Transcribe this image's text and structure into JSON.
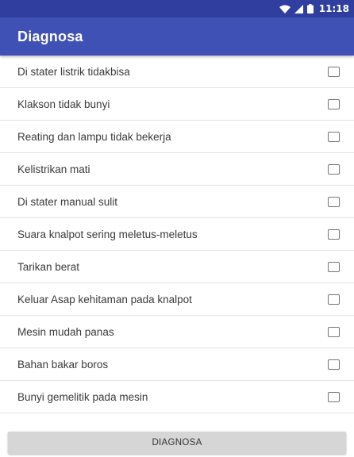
{
  "status_bar": {
    "time": "11:18",
    "icons": [
      "wifi-icon",
      "signal-icon",
      "battery-icon"
    ],
    "background": "#303f9f"
  },
  "app_bar": {
    "title": "Diagnosa",
    "background": "#3f51b5"
  },
  "symptoms": [
    {
      "label": "Di stater listrik tidakbisa",
      "checked": false
    },
    {
      "label": "Klakson tidak bunyi",
      "checked": false
    },
    {
      "label": "Reating dan lampu tidak bekerja",
      "checked": false
    },
    {
      "label": "Kelistrikan mati",
      "checked": false
    },
    {
      "label": "Di stater manual sulit",
      "checked": false
    },
    {
      "label": "Suara knalpot sering meletus-meletus",
      "checked": false
    },
    {
      "label": "Tarikan berat",
      "checked": false
    },
    {
      "label": "Keluar Asap kehitaman pada knalpot",
      "checked": false
    },
    {
      "label": "Mesin mudah panas",
      "checked": false
    },
    {
      "label": "Bahan bakar boros",
      "checked": false
    },
    {
      "label": "Bunyi gemelitik pada mesin",
      "checked": false
    }
  ],
  "footer": {
    "button_label": "DIAGNOSA"
  }
}
